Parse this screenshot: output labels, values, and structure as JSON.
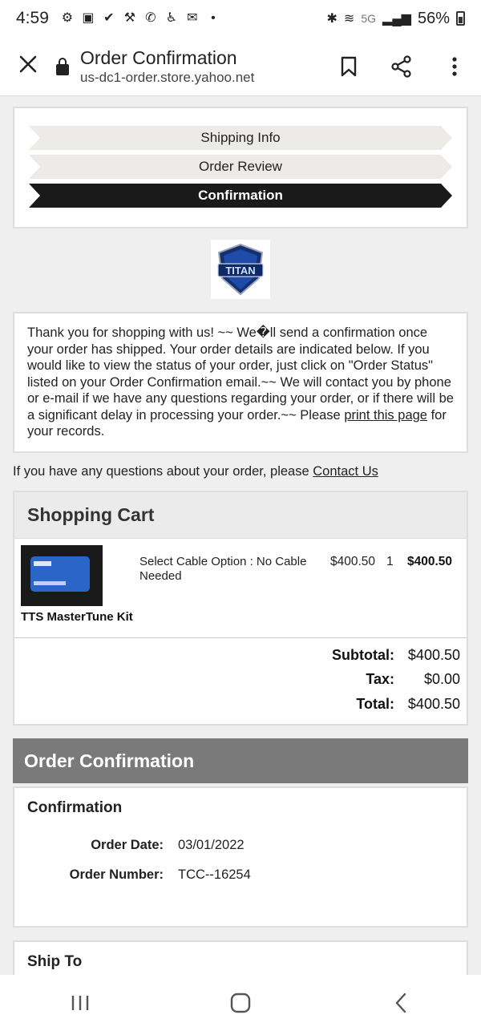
{
  "status_bar": {
    "time": "4:59",
    "network": "5G",
    "battery": "56%"
  },
  "browser": {
    "title": "Order Confirmation",
    "url": "us-dc1-order.store.yahoo.net"
  },
  "steps": [
    {
      "label": "Shipping Info",
      "active": false
    },
    {
      "label": "Order Review",
      "active": false
    },
    {
      "label": "Confirmation",
      "active": true
    }
  ],
  "logo": {
    "text": "TITAN"
  },
  "message": {
    "text": "Thank you for shopping with us! ~~ We�ll send a confirmation once your order has shipped. Your order details are indicated below. If you would like to view the status of your order, just click on \"Order Status\" listed on your Order Confirmation email.~~ We will contact you by phone or e-mail if we have any questions regarding your order, or if there will be a significant delay in processing your order.~~ Please ",
    "link": "print this page",
    "tail": " for your records."
  },
  "questions": {
    "text": "If you have any questions about your order, please ",
    "link": "Contact Us"
  },
  "cart": {
    "heading": "Shopping Cart",
    "item": {
      "name": "TTS MasterTune Kit",
      "option": "Select Cable Option : No Cable Needed",
      "price": "$400.50",
      "qty": "1",
      "total": "$400.50"
    },
    "subtotal_label": "Subtotal:",
    "subtotal": "$400.50",
    "tax_label": "Tax:",
    "tax": "$0.00",
    "total_label": "Total:",
    "total": "$400.50"
  },
  "order": {
    "heading": "Order Confirmation",
    "section_title": "Confirmation",
    "date_label": "Order Date:",
    "date": "03/01/2022",
    "number_label": "Order Number:",
    "number": "TCC--16254",
    "ship_to_title": "Ship To"
  },
  "colors": {
    "step_inactive": "#ecebe8",
    "step_active": "#1a1a1a",
    "order_header": "#7a7a7a"
  }
}
